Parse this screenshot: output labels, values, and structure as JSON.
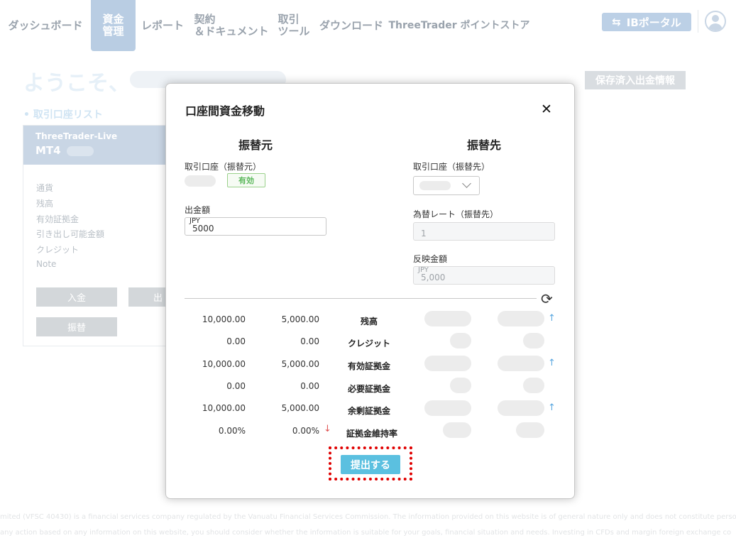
{
  "nav": {
    "items": [
      {
        "label": "ダッシュボード",
        "active": false
      },
      {
        "label": "資金\n管理",
        "active": true
      },
      {
        "label": "レポート",
        "active": false
      },
      {
        "label": "契約\n＆ドキュメント",
        "active": false
      },
      {
        "label": "取引\nツール",
        "active": false
      },
      {
        "label": "ダウンロード",
        "active": false
      },
      {
        "label": "ThreeTrader ポイントストア",
        "active": false
      }
    ],
    "ib_portal": "IBポータル"
  },
  "page": {
    "welcome": "ようこそ、",
    "saved_info_button": "保存済入出金情報",
    "account_list_label": "• 取引口座リスト",
    "card": {
      "broker": "ThreeTrader-Live",
      "platform": "MT4",
      "lines": [
        "通貨",
        "残高",
        "有効証拠金",
        "引き出し可能金額",
        "クレジット",
        "Note"
      ],
      "deposit": "入金",
      "withdraw": "出",
      "transfer": "振替"
    },
    "footer_line1": "mited (VFSC 40430) is a financial services company regulated by the Vanuatu Financial Services Commission. The information provided on this website is of general nature only and does not constitute personal",
    "footer_line2": "any action based on any information on this website, you should consider whether the information is suitable for your goals, financial situation and needs. Investing in CFDs and margin foreign exchange co"
  },
  "modal": {
    "title": "口座間資金移動",
    "from_heading": "振替元",
    "to_heading": "振替先",
    "from_account_label": "取引口座（振替元）",
    "status_badge": "有効",
    "amount_label": "出金額",
    "amount_currency": "JPY",
    "amount_value": "5000",
    "to_account_label": "取引口座（振替先）",
    "rate_label": "為替レート（振替先）",
    "rate_value": "1",
    "reflected_label": "反映金額",
    "reflected_currency": "JPY",
    "reflected_value": "5,000",
    "rows": [
      {
        "before": "10,000.00",
        "after": "5,000.00",
        "label": "残高",
        "to_arrow": "up",
        "from_arrow": ""
      },
      {
        "before": "0.00",
        "after": "0.00",
        "label": "クレジット",
        "to_arrow": "",
        "from_arrow": ""
      },
      {
        "before": "10,000.00",
        "after": "5,000.00",
        "label": "有効証拠金",
        "to_arrow": "up",
        "from_arrow": ""
      },
      {
        "before": "0.00",
        "after": "0.00",
        "label": "必要証拠金",
        "to_arrow": "",
        "from_arrow": ""
      },
      {
        "before": "10,000.00",
        "after": "5,000.00",
        "label": "余剰証拠金",
        "to_arrow": "up",
        "from_arrow": ""
      },
      {
        "before": "0.00%",
        "after": "0.00%",
        "label": "証拠金維持率",
        "to_arrow": "",
        "from_arrow": "down"
      }
    ],
    "submit": "提出する"
  },
  "colors": {
    "accent": "#5bc0e0",
    "nav_active": "#b9cde3",
    "valid_green": "#5cb85c",
    "arrow_up": "#5aa7e0",
    "arrow_down": "#e05555",
    "highlight_frame": "#e00000"
  }
}
